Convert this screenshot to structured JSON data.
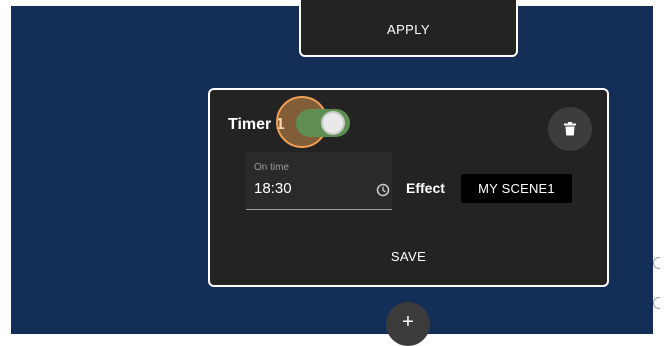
{
  "top_card": {
    "apply_label": "APPLY"
  },
  "timer_card": {
    "title": "Timer 1",
    "toggle_on": true,
    "time_field": {
      "label": "On time",
      "value": "18:30"
    },
    "effect_label": "Effect",
    "scene_button_label": "MY SCENE1",
    "save_label": "SAVE"
  },
  "add_button_label": "+",
  "icons": {
    "delete": "trash-icon",
    "clock": "clock-icon"
  },
  "colors": {
    "background": "#132e57",
    "card": "#232323",
    "toggle_on": "#5f8e52",
    "focus": "#f0a055"
  }
}
